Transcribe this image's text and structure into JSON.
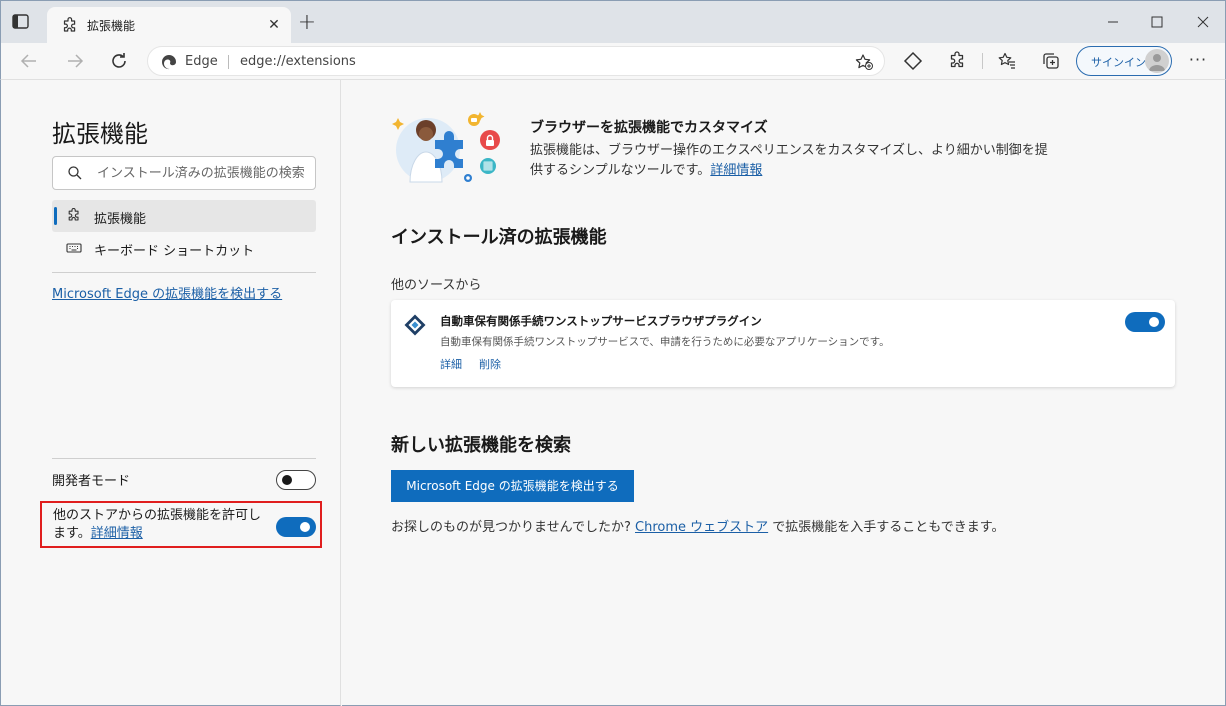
{
  "browser": {
    "tab": {
      "title": "拡張機能",
      "close_glyph": "✕"
    },
    "new_tab_glyph": "+",
    "address": {
      "brand": "Edge",
      "url": "edge://extensions"
    },
    "signin_label": "サインイン",
    "more_glyph": "···"
  },
  "sidebar": {
    "heading": "拡張機能",
    "search_placeholder": "インストール済みの拡張機能の検索",
    "items": [
      {
        "label": "拡張機能",
        "icon": "puzzle-icon",
        "active": true
      },
      {
        "label": "キーボード ショートカット",
        "icon": "keyboard-icon",
        "active": false
      }
    ],
    "discover_link": "Microsoft Edge の拡張機能を検出する",
    "developer_mode": {
      "label": "開発者モード",
      "enabled": false
    },
    "allow_other_stores": {
      "label": "他のストアからの拡張機能を許可します。",
      "link": "詳細情報",
      "enabled": true
    }
  },
  "main": {
    "hero": {
      "title": "ブラウザーを拡張機能でカスタマイズ",
      "description": "拡張機能は、ブラウザー操作のエクスペリエンスをカスタマイズし、より細かい制御を提供するシンプルなツールです。",
      "link": "詳細情報"
    },
    "installed_title": "インストール済の拡張機能",
    "source_label": "他のソースから",
    "extensions": [
      {
        "name": "自動車保有関係手続ワンストップサービスブラウザプラグイン",
        "description": "自動車保有関係手続ワンストップサービスで、申請を行うために必要なアプリケーションです。",
        "details_label": "詳細",
        "remove_label": "削除",
        "enabled": true
      }
    ],
    "find_new_title": "新しい拡張機能を検索",
    "store_button": "Microsoft Edge の拡張機能を検出する",
    "not_found_prefix": "お探しのものが見つかりませんでしたか? ",
    "chrome_store_link": "Chrome ウェブストア",
    "not_found_suffix": " で拡張機能を入手することもできます。"
  },
  "colors": {
    "accent": "#0f6cbd",
    "highlight_border": "#e01e1e",
    "link": "#1b5fa6"
  }
}
